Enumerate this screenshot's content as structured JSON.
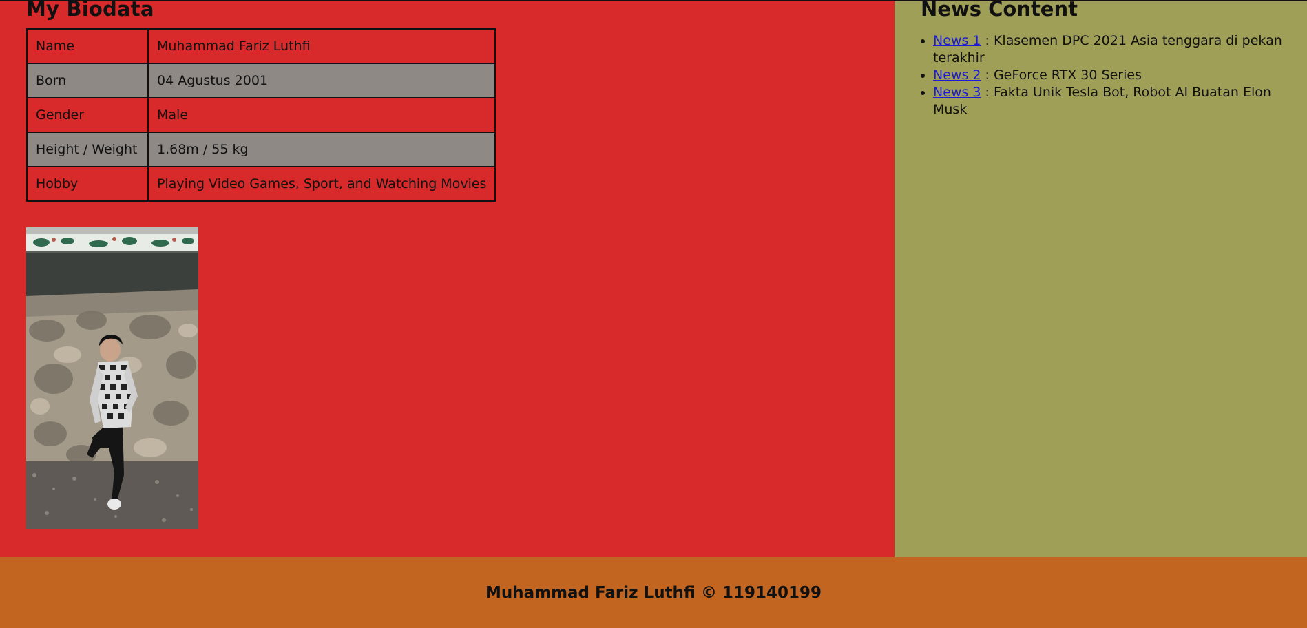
{
  "main": {
    "title": "My Biodata",
    "biodata": [
      {
        "label": "Name",
        "value": "Muhammad Fariz Luthfi"
      },
      {
        "label": "Born",
        "value": "04 Agustus 2001"
      },
      {
        "label": "Gender",
        "value": "Male"
      },
      {
        "label": "Height / Weight",
        "value": "1.68m / 55 kg"
      },
      {
        "label": "Hobby",
        "value": "Playing Video Games, Sport, and Watching Movies"
      }
    ]
  },
  "sidebar": {
    "title": "News Content",
    "news": [
      {
        "link": "News 1",
        "text": " : Klasemen DPC 2021 Asia tenggara di pekan terakhir"
      },
      {
        "link": "News 2",
        "text": " : GeForce RTX 30 Series"
      },
      {
        "link": "News 3",
        "text": " : Fakta Unik Tesla Bot, Robot AI Buatan Elon Musk"
      }
    ]
  },
  "footer": {
    "text": "Muhammad Fariz Luthfi © 119140199"
  },
  "colors": {
    "main_bg": "#d82a2b",
    "row_alt_bg": "#8f8985",
    "sidebar_bg": "#9f9f58",
    "footer_bg": "#c26521",
    "link": "#1b1bd8"
  }
}
